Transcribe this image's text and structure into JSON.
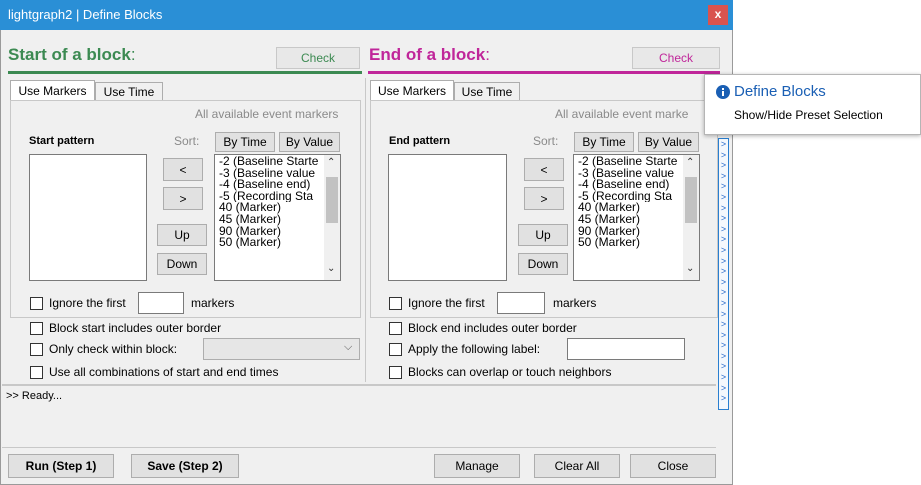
{
  "window": {
    "title": "lightgraph2 | Define Blocks",
    "close_label": "x"
  },
  "start": {
    "title": "Start of a block",
    "colon": ":",
    "check_label": "Check",
    "tabs": [
      "Use Markers",
      "Use Time"
    ],
    "available_label": "All available event markers",
    "pattern_label": "Start pattern",
    "sort_label": "Sort:",
    "sort_time": "By Time",
    "sort_value": "By Value",
    "btn_left": "<",
    "btn_right": ">",
    "btn_up": "Up",
    "btn_down": "Down",
    "markers": [
      "-2 (Baseline Starte",
      "-3 (Baseline value",
      "-4 (Baseline end)",
      "-5 (Recording Sta",
      "40 (Marker)",
      "45 (Marker)",
      "90 (Marker)",
      "50 (Marker)"
    ],
    "ignore_prefix": "Ignore the first",
    "ignore_suffix": "markers",
    "opt1": "Block start includes outer border",
    "opt2": "Only check within block:",
    "opt3": "Use all combinations of start and end times"
  },
  "end": {
    "title": "End of a block",
    "colon": ":",
    "check_label": "Check",
    "tabs": [
      "Use Markers",
      "Use Time"
    ],
    "available_label": "All available event marke",
    "pattern_label": "End pattern",
    "sort_label": "Sort:",
    "sort_time": "By Time",
    "sort_value": "By Value",
    "btn_left": "<",
    "btn_right": ">",
    "btn_up": "Up",
    "btn_down": "Down",
    "markers": [
      "-2 (Baseline Starte",
      "-3 (Baseline value",
      "-4 (Baseline end)",
      "-5 (Recording Sta",
      "40 (Marker)",
      "45 (Marker)",
      "90 (Marker)",
      "50 (Marker)"
    ],
    "ignore_prefix": "Ignore the first",
    "ignore_suffix": "markers",
    "opt1": "Block end includes outer border",
    "opt2": "Apply the following label:",
    "opt3": "Blocks can overlap or touch neighbors"
  },
  "status": ">> Ready...",
  "footer": {
    "run": "Run (Step 1)",
    "save": "Save (Step 2)",
    "manage": "Manage",
    "clear_all": "Clear All",
    "close": "Close"
  },
  "tooltip": {
    "title": "Define Blocks",
    "subtitle": "Show/Hide Preset Selection",
    "icon": "info-icon"
  },
  "sidestrip": {
    "arrow": ">"
  },
  "colors": {
    "title_bar": "#2a8fd6",
    "start_accent": "#3c8a52",
    "end_accent": "#c0269a",
    "link_blue": "#1a5fb4"
  }
}
